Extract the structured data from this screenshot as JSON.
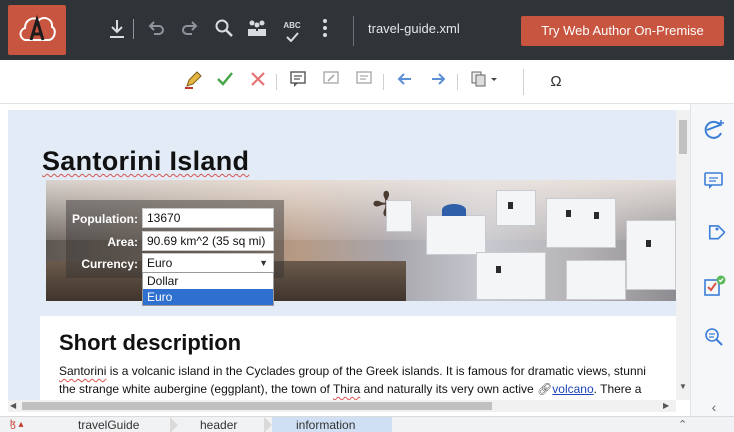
{
  "toolbar": {
    "filename": "travel-guide.xml",
    "try_button": "Try Web Author On-Premise",
    "spellcheck_label": "ABC",
    "icons": [
      "download-icon",
      "undo-icon",
      "redo-icon",
      "search-icon",
      "people-icon",
      "spellcheck-icon",
      "more-icon"
    ]
  },
  "toolbar2": {
    "icons": [
      "track-changes-icon",
      "accept-icon",
      "reject-icon",
      "comment-icon",
      "edit-comment-icon",
      "reply-comment-icon",
      "previous-icon",
      "next-icon",
      "copy-menu-icon",
      "omega-icon"
    ],
    "omega": "Ω"
  },
  "document": {
    "title": "Santorini Island",
    "fields": [
      {
        "label": "Population:",
        "value": "13670"
      },
      {
        "label": "Area:",
        "value": "90.69 km^2 (35 sq mi)"
      },
      {
        "label": "Currency:",
        "value": "Euro"
      }
    ],
    "currency_options": [
      "Dollar",
      "Euro"
    ],
    "currency_selected": "Euro",
    "section_title": "Short description",
    "para": {
      "word1": "Santorini",
      "line1_rest": " is a volcanic island in the Cyclades group of the Greek islands. It is famous for dramatic views, stunni",
      "line2_a": "the strange white aubergine (eggplant), the town of ",
      "thira": "Thira",
      "line2_b": " and naturally its very own active ",
      "link": "volcano",
      "line2_c": ". There a"
    }
  },
  "breadcrumb": {
    "items": [
      "travelGuide",
      "header",
      "information"
    ],
    "active": "information"
  },
  "colors": {
    "topbar": "#2f3438",
    "accent": "#c8553f",
    "selection": "#2f6fd0",
    "link": "#1d44b8",
    "sidebar_icon": "#3b7ed8"
  }
}
